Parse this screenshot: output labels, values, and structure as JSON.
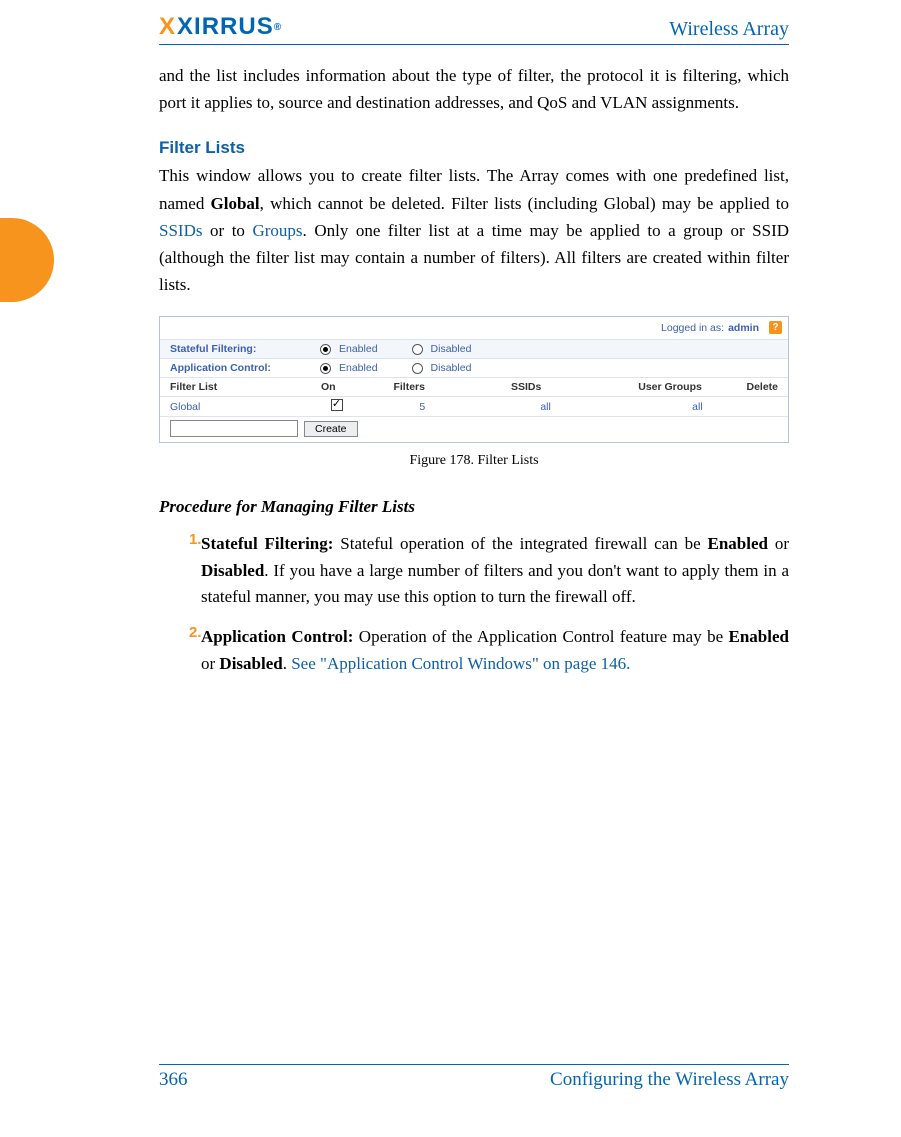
{
  "brand": {
    "name": "XIRRUS",
    "reg": "®"
  },
  "header": {
    "title": "Wireless Array"
  },
  "intro": "and the list includes information about the type of filter, the protocol it is filtering, which port it applies to, source and destination addresses, and QoS and VLAN assignments.",
  "section_heading": "Filter Lists",
  "body1_pre": "This window allows you to create filter lists. The Array comes with one predefined list, named ",
  "body1_global": "Global",
  "body1_mid": ", which cannot be deleted. Filter lists (including Global) may be applied to ",
  "body1_ssids": "SSIDs",
  "body1_or": " or to ",
  "body1_groups": "Groups",
  "body1_post": ". Only one filter list at a time may be applied to a group or SSID (although the filter list may contain a number of filters). All filters are created within filter lists.",
  "fig_caption": "Figure 178. Filter Lists",
  "procedure_heading": "Procedure for Managing Filter Lists",
  "items": [
    {
      "num": "1.",
      "lead": "Stateful Filtering:",
      "pre": " Stateful operation of the integrated firewall can be ",
      "b1": "Enabled",
      "mid": " or ",
      "b2": "Disabled",
      "post": ". If you have a large number of filters and you don't want to apply them in a stateful manner, you may use this option to turn the firewall off.",
      "link": ""
    },
    {
      "num": "2.",
      "lead": "Application Control:",
      "pre": " Operation of the Application Control feature may be ",
      "b1": "Enabled",
      "mid": " or ",
      "b2": "Disabled",
      "post": ". ",
      "link": "See \"Application Control Windows\" on page 146."
    }
  ],
  "screenshot": {
    "logged_prefix": "Logged in as:",
    "logged_user": "admin",
    "stateful_label": "Stateful Filtering:",
    "appcontrol_label": "Application Control:",
    "enabled": "Enabled",
    "disabled": "Disabled",
    "cols": {
      "fl": "Filter List",
      "on": "On",
      "filters": "Filters",
      "ssids": "SSIDs",
      "ug": "User Groups",
      "del": "Delete"
    },
    "row": {
      "name": "Global",
      "filters": "5",
      "ssids": "all",
      "ug": "all"
    },
    "create_btn": "Create"
  },
  "footer": {
    "page": "366",
    "chapter": "Configuring the Wireless Array"
  }
}
